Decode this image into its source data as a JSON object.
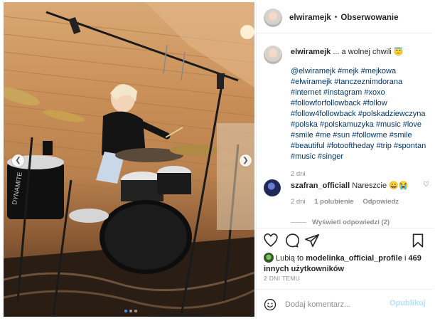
{
  "post": {
    "username": "elwiramejk",
    "follow_label": "Obserwowanie",
    "separator": "•"
  },
  "caption": {
    "username": "elwiramejk",
    "text": " ... a wolnej chwili 😇",
    "hashtags": "@elwiramejk #mejk #mejkowa #elwiramejk #tanczeznimdorana #internet #instagram #xoxo #followforfollowback #follow #follow4followback #polskadziewczyna #polska #polskamuzyka #music #love #smile #me #sun #followme #smile #beautiful #fotooftheday #trip #spontan #music #singer",
    "time": "2 dni"
  },
  "comment": {
    "username": "szafran_officiall",
    "text": " Nareszcie 😀😭",
    "time": "2 dni",
    "likes": "1 polubienie",
    "reply_label": "Odpowiedz",
    "view_replies": "Wyświetl odpowiedzi (2)"
  },
  "likes": {
    "prefix": "Lubią to ",
    "liker": "modelinka_official_profile",
    "middle": " i ",
    "others": "469 innych użytkowników"
  },
  "post_time": "2 DNI TEMU",
  "composer": {
    "placeholder": "Dodaj komentarz...",
    "post_label": "Opublikuj"
  },
  "icons": [
    "heart-icon",
    "comment-icon",
    "share-icon",
    "bookmark-icon",
    "emoji-icon",
    "chevron-left-icon",
    "chevron-right-icon"
  ],
  "colors": {
    "link": "#00376b",
    "muted": "#8e8e8e",
    "post_button": "#b2dffc",
    "active_dot": "#3897f0"
  }
}
